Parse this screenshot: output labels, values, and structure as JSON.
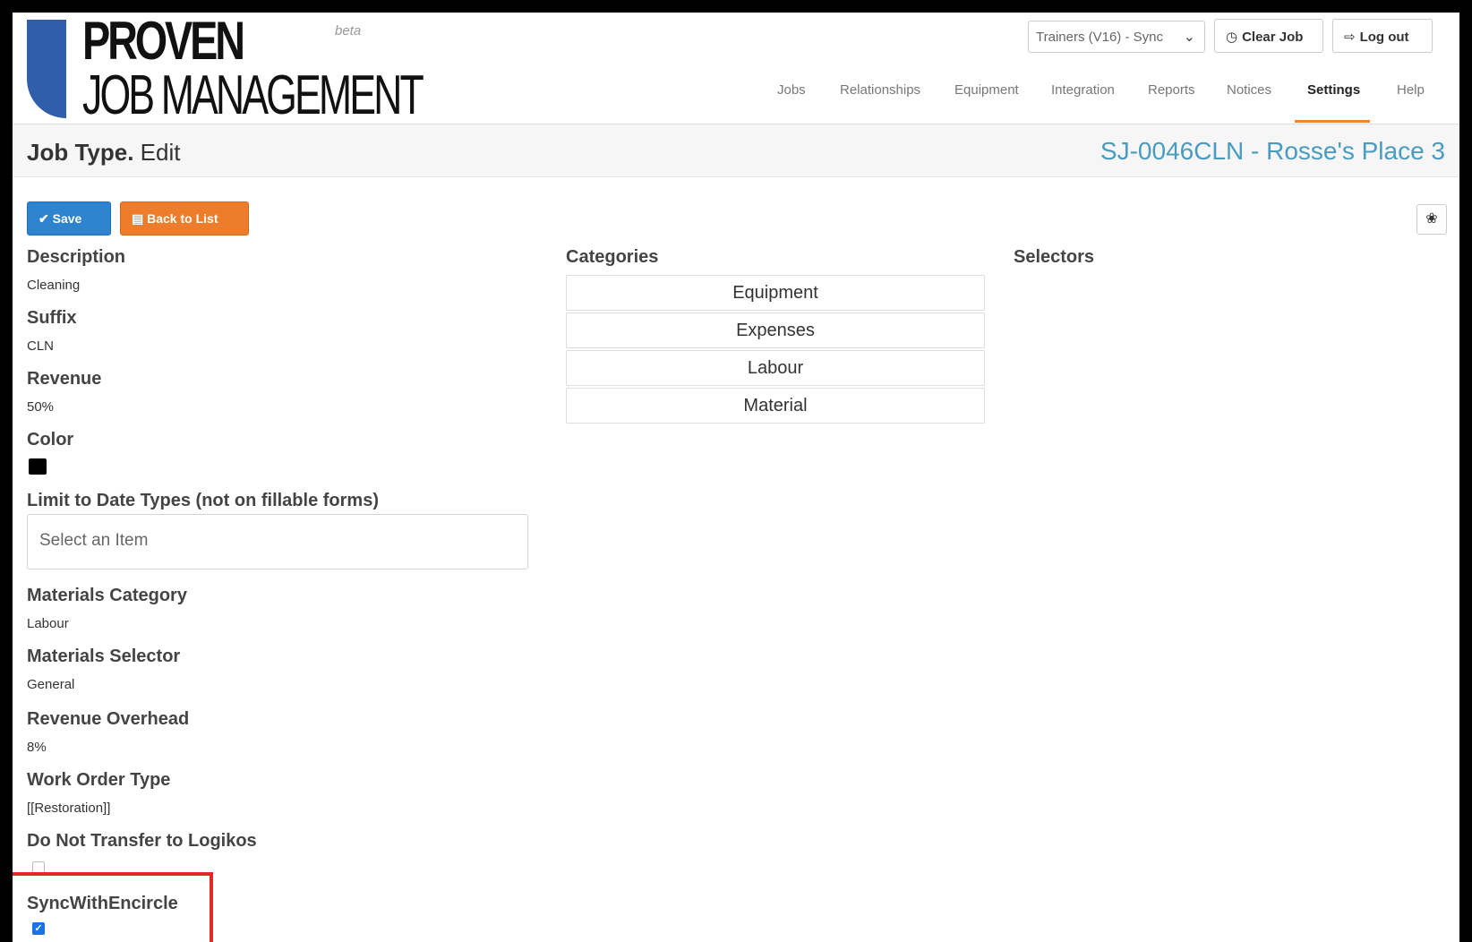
{
  "header": {
    "logo_top": "PROVEN",
    "logo_bottom": "JOB MANAGEMENT",
    "beta": "beta",
    "job_select_value": "Trainers (V16) - Sync",
    "clear_job_label": "Clear Job",
    "logout_label": "Log out",
    "nav": [
      {
        "label": "Jobs"
      },
      {
        "label": "Relationships"
      },
      {
        "label": "Equipment"
      },
      {
        "label": "Integration"
      },
      {
        "label": "Reports"
      },
      {
        "label": "Notices"
      },
      {
        "label": "Settings",
        "active": true
      },
      {
        "label": "Help"
      }
    ],
    "accent_color": "#f0852b"
  },
  "title": {
    "main": "Job Type.",
    "sub": "Edit",
    "job_ref": "SJ-0046CLN - Rosse's Place 3"
  },
  "actions": {
    "save_label": "Save",
    "back_label": "Back to List"
  },
  "fields": {
    "description_label": "Description",
    "description_value": "Cleaning",
    "suffix_label": "Suffix",
    "suffix_value": "CLN",
    "revenue_label": "Revenue",
    "revenue_value": "50%",
    "color_label": "Color",
    "color_value": "#000000",
    "limit_label": "Limit to Date Types (not on fillable forms)",
    "limit_placeholder": "Select an Item",
    "materials_category_label": "Materials Category",
    "materials_category_value": "Labour",
    "materials_selector_label": "Materials Selector",
    "materials_selector_value": "General",
    "revenue_overhead_label": "Revenue Overhead",
    "revenue_overhead_value": "8%",
    "work_order_type_label": "Work Order Type",
    "work_order_type_value": "[[Restoration]]",
    "no_transfer_label": "Do Not Transfer to Logikos",
    "no_transfer_checked": false,
    "sync_label": "SyncWithEncircle",
    "sync_checked": true
  },
  "categories": {
    "label": "Categories",
    "items": [
      "Equipment",
      "Expenses",
      "Labour",
      "Material"
    ]
  },
  "selectors": {
    "label": "Selectors"
  }
}
